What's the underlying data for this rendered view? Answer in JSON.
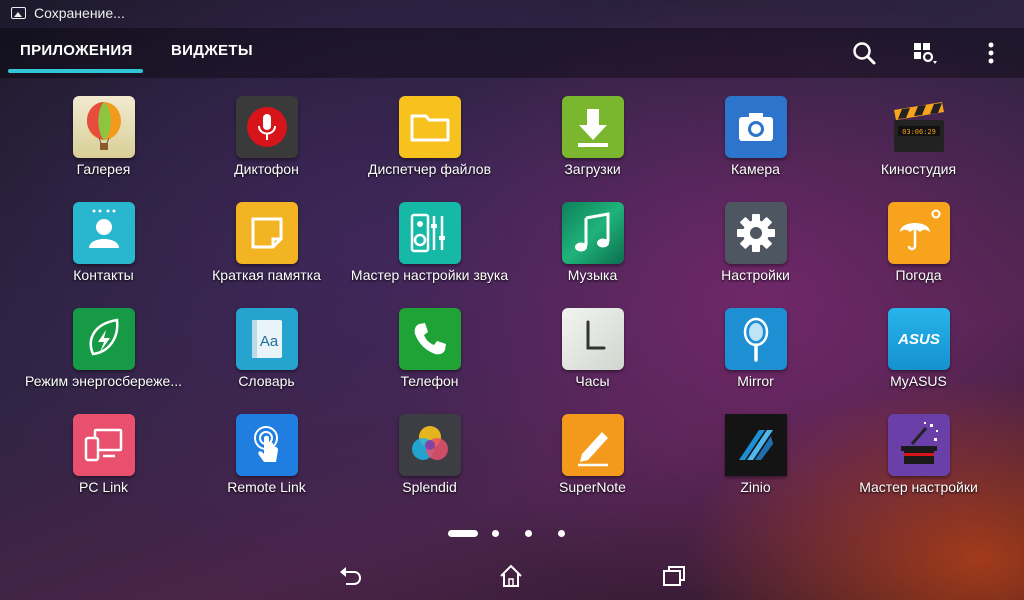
{
  "status_bar": {
    "notification_text": "Сохранение...",
    "icon": "image-icon"
  },
  "tabs": [
    {
      "label": "ПРИЛОЖЕНИЯ",
      "active": true
    },
    {
      "label": "ВИДЖЕТЫ",
      "active": false
    }
  ],
  "toolbar": {
    "icons": [
      "search-icon",
      "grid-settings-icon",
      "overflow-menu-icon"
    ]
  },
  "colors": {
    "accent": "#30c6d8"
  },
  "apps": [
    {
      "label": "Галерея",
      "icon": "balloon-icon",
      "color": "#e8dfb0"
    },
    {
      "label": "Диктофон",
      "icon": "microphone-icon",
      "color": "#3a3a3a"
    },
    {
      "label": "Диспетчер файлов",
      "icon": "folder-icon",
      "color": "#f7c21d"
    },
    {
      "label": "Загрузки",
      "icon": "download-icon",
      "color": "#7ab62e"
    },
    {
      "label": "Камера",
      "icon": "camera-icon",
      "color": "#2d74cc"
    },
    {
      "label": "Киностудия",
      "icon": "clapperboard-icon",
      "color": "#000000"
    },
    {
      "label": "Контакты",
      "icon": "contact-icon",
      "color": "#29b6cf"
    },
    {
      "label": "Краткая памятка",
      "icon": "note-icon",
      "color": "#f2b422"
    },
    {
      "label": "Мастер настройки звука",
      "icon": "equalizer-icon",
      "color": "#16b9a6"
    },
    {
      "label": "Музыка",
      "icon": "music-note-icon",
      "color": "#139d6c"
    },
    {
      "label": "Настройки",
      "icon": "gear-icon",
      "color": "#4d5661"
    },
    {
      "label": "Погода",
      "icon": "umbrella-sun-icon",
      "color": "#f7a31d"
    },
    {
      "label": "Режим энергосбереже...",
      "icon": "leaf-icon",
      "color": "#179a46"
    },
    {
      "label": "Словарь",
      "icon": "dictionary-icon",
      "color": "#27a3cf"
    },
    {
      "label": "Телефон",
      "icon": "phone-icon",
      "color": "#1fa336"
    },
    {
      "label": "Часы",
      "icon": "clock-icon",
      "color": "#e5e8e3"
    },
    {
      "label": "Mirror",
      "icon": "hand-mirror-icon",
      "color": "#1f8fd4"
    },
    {
      "label": "MyASUS",
      "icon": "asus-logo-icon",
      "color": "#1da9e1"
    },
    {
      "label": "PC Link",
      "icon": "pc-link-icon",
      "color": "#e8506d"
    },
    {
      "label": "Remote Link",
      "icon": "touch-icon",
      "color": "#1f7ee0"
    },
    {
      "label": "Splendid",
      "icon": "color-circles-icon",
      "color": "#3c3e44"
    },
    {
      "label": "SuperNote",
      "icon": "pencil-icon",
      "color": "#f39a1d"
    },
    {
      "label": "Zinio",
      "icon": "zinio-logo-icon",
      "color": "#141414"
    },
    {
      "label": "Мастер настройки",
      "icon": "magic-hat-icon",
      "color": "#6b3fa8"
    }
  ],
  "pager": {
    "pages": 4,
    "current": 1
  },
  "nav_bar": {
    "icons": [
      "back-icon",
      "home-icon",
      "recent-apps-icon"
    ]
  }
}
